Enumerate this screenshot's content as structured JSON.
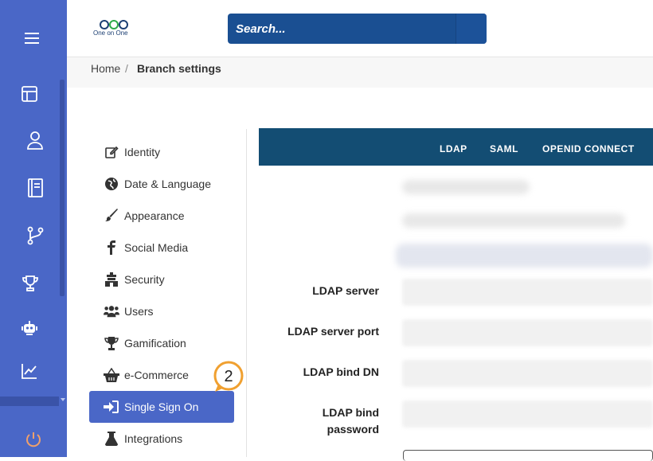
{
  "rail": {
    "icons": [
      "menu-icon",
      "layout-icon",
      "user-icon",
      "book-icon",
      "branch-icon",
      "trophy-icon",
      "robot-icon",
      "chart-icon",
      "power-icon"
    ],
    "accent": "#4a67c7",
    "power_color": "#f0a06b"
  },
  "topbar": {
    "logo_text": "One on One",
    "search_placeholder": "Search..."
  },
  "breadcrumb": {
    "home": "Home",
    "separator": "/",
    "current": "Branch settings"
  },
  "settings_nav": {
    "items": [
      {
        "label": "Identity",
        "icon": "edit-icon"
      },
      {
        "label": "Date & Language",
        "icon": "globe-icon"
      },
      {
        "label": "Appearance",
        "icon": "brush-icon"
      },
      {
        "label": "Social Media",
        "icon": "facebook-icon"
      },
      {
        "label": "Security",
        "icon": "fort-icon"
      },
      {
        "label": "Users",
        "icon": "users-icon"
      },
      {
        "label": "Gamification",
        "icon": "trophy-icon"
      },
      {
        "label": "e-Commerce",
        "icon": "basket-icon"
      },
      {
        "label": "Single Sign On",
        "icon": "sign-in-icon",
        "active": true
      },
      {
        "label": "Integrations",
        "icon": "flask-icon"
      }
    ],
    "badge": "2",
    "badge_color": "#f0a030"
  },
  "tabs": {
    "items": [
      "LDAP",
      "SAML",
      "OPENID CONNECT"
    ],
    "bar_color": "#134d73"
  },
  "form": {
    "ldap_server_label": "LDAP server",
    "ldap_port_label": "LDAP server port",
    "ldap_bind_dn_label": "LDAP bind DN",
    "ldap_bind_password_label_1": "LDAP bind",
    "ldap_bind_password_label_2": "password"
  }
}
